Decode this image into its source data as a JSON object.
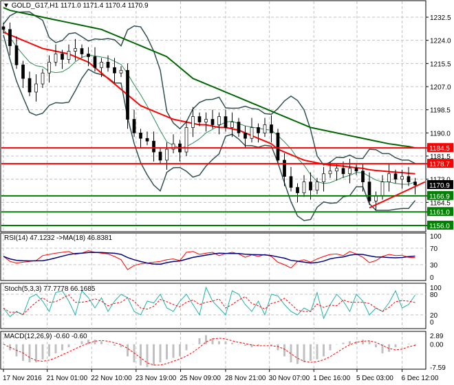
{
  "header": {
    "symbol": "GOLD_G17,H1",
    "ohlc": "1171.0 1171.4 1170.4 1170.9"
  },
  "rsi_label": "RSI(14) 47.1232  ->MA(18) 46.8381",
  "stoch_label": "Stoch(5,3,3) 77.7778 66.1685",
  "macd_label": "MACD(12,26,9) -0.60 -0.60",
  "colors": {
    "bull_bear_bars": "#000000",
    "ma_fast": "#ff0000",
    "ma_slow": "#006400",
    "bands": "#2f4f4f",
    "support": "#008000",
    "resistance": "#ff0000",
    "rsi": "#ff0000",
    "rsi_ma": "#000080",
    "stoch_main": "#20b2aa",
    "stoch_signal": "#ff0000",
    "macd_hist": "#c0c0c0"
  },
  "chart_data": [
    {
      "type": "line",
      "title": "GOLD_G17,H1",
      "y_ticks": [
        "1232.5",
        "1224.0",
        "1215.5",
        "1207.0",
        "1198.5",
        "1190.0",
        "1181.5",
        "1173.0",
        "1164.5"
      ],
      "ylim": [
        1154,
        1238
      ],
      "x_tick_labels": [
        "17 Nov 2016",
        "21 Nov 01:00",
        "22 Nov 10:00",
        "23 Nov 19:00",
        "25 Nov 09:00",
        "28 Nov 21:00",
        "30 Nov 07:00",
        "1 Dec 16:00",
        "5 Dec 03:00",
        "6 Dec 12:00"
      ],
      "x_tick_index": [
        0,
        6.7,
        13.5,
        20.3,
        27.1,
        34,
        40.7,
        47.5,
        54.1,
        61
      ],
      "close": [
        1228,
        1222,
        1215,
        1210,
        1205,
        1208,
        1212,
        1216,
        1219,
        1217,
        1220,
        1221,
        1219,
        1218,
        1214,
        1216,
        1214,
        1212,
        1213,
        1195,
        1190,
        1188,
        1187,
        1183,
        1180,
        1184,
        1186,
        1183,
        1192,
        1196,
        1194,
        1195,
        1193,
        1196,
        1192,
        1194,
        1190,
        1188,
        1192,
        1190,
        1193,
        1190,
        1180,
        1174,
        1170,
        1168,
        1172,
        1169,
        1172,
        1175,
        1176,
        1177,
        1175,
        1177,
        1176,
        1172,
        1165,
        1167,
        1172,
        1175,
        1173,
        1174,
        1172,
        1170.9
      ],
      "ma_red": [
        1227,
        1226,
        1225,
        1224,
        1223,
        1222,
        1221,
        1220.5,
        1220,
        1219.5,
        1219,
        1218,
        1217,
        1216,
        1214,
        1212,
        1210,
        1208,
        1206,
        1204,
        1202,
        1200,
        1199,
        1198,
        1197,
        1196,
        1195,
        1194.5,
        1194,
        1193.5,
        1193,
        1193,
        1192.5,
        1192,
        1192,
        1191.5,
        1191,
        1190,
        1189,
        1188,
        1187,
        1186,
        1184,
        1183,
        1182,
        1181,
        1180,
        1179.5,
        1179,
        1178.5,
        1178.2,
        1178,
        1177.8,
        1177.5,
        1177.2,
        1177,
        1176.5,
        1176.2,
        1176,
        1175.8,
        1175.6,
        1175.4,
        1175.2,
        1175
      ],
      "ma_green": [
        1236,
        1235,
        1234.5,
        1234,
        1233.5,
        1233,
        1232.5,
        1232,
        1231.5,
        1231,
        1230.5,
        1230,
        1229.5,
        1229,
        1228.5,
        1228,
        1227,
        1226,
        1225,
        1224,
        1223,
        1222,
        1221,
        1220,
        1219,
        1218,
        1216,
        1214,
        1212,
        1210,
        1209,
        1208,
        1207,
        1206,
        1205,
        1204,
        1203,
        1202,
        1201,
        1200,
        1199,
        1198,
        1197,
        1196,
        1195,
        1194,
        1193,
        1192,
        1191.5,
        1191,
        1190.5,
        1190,
        1189.5,
        1189,
        1188.5,
        1188,
        1187.5,
        1187,
        1186.5,
        1186,
        1185.7,
        1185.3,
        1185,
        1184.5
      ],
      "levels": [
        {
          "value": 1184.5,
          "label": "1184.5",
          "kind": "resistance"
        },
        {
          "value": 1178.7,
          "label": "1178.7",
          "kind": "resistance"
        },
        {
          "value": 1166.9,
          "label": "1166.9",
          "kind": "support"
        },
        {
          "value": 1161.0,
          "label": "1161.0",
          "kind": "support"
        },
        {
          "value": 1156.0,
          "label": "1156.0",
          "kind": "support"
        }
      ],
      "current_price": "1170.9",
      "trendline": {
        "from": [
          56,
          1162.5
        ],
        "to": [
          64.5,
          1172
        ]
      }
    },
    {
      "type": "line",
      "title": "RSI(14)",
      "ylim": [
        0,
        100
      ],
      "y_ticks": [
        "100",
        "70",
        "30",
        "0"
      ],
      "rsi": [
        50,
        38,
        34,
        36,
        38,
        40,
        52,
        55,
        58,
        60,
        62,
        55,
        58,
        64,
        60,
        58,
        56,
        50,
        42,
        18,
        28,
        32,
        34,
        36,
        38,
        42,
        44,
        40,
        60,
        62,
        55,
        58,
        60,
        52,
        57,
        60,
        56,
        48,
        54,
        50,
        55,
        50,
        36,
        30,
        22,
        38,
        42,
        36,
        44,
        50,
        55,
        56,
        52,
        62,
        56,
        48,
        35,
        40,
        50,
        55,
        52,
        53,
        48,
        47.1
      ],
      "stoch_main": [
        40,
        15,
        30,
        20,
        70,
        80,
        60,
        30,
        85,
        90,
        60,
        20,
        90,
        70,
        40,
        70,
        30,
        60,
        80,
        70,
        30,
        20,
        60,
        55,
        80,
        40,
        30,
        60,
        80,
        50,
        20,
        100,
        60,
        40,
        20,
        90,
        80,
        50,
        30,
        60,
        20,
        80,
        75,
        50,
        30,
        20,
        40,
        30,
        85,
        10,
        50,
        80,
        60,
        30,
        80,
        60,
        20,
        40,
        30,
        55,
        90,
        40,
        50,
        77.8
      ],
      "macd_hist": [
        0,
        -2,
        -4,
        -5.5,
        -6,
        -6,
        -5,
        -4,
        -3,
        -2,
        -1,
        0,
        1,
        1.5,
        1.5,
        1,
        0,
        -0.5,
        -1,
        -4,
        -6,
        -7,
        -7.5,
        -7,
        -6,
        -5,
        -4.5,
        -4,
        -2,
        0,
        2,
        3,
        2,
        1,
        1,
        0.5,
        0,
        -0.5,
        -1,
        -0.5,
        0,
        -0.5,
        -2,
        -4,
        -6,
        -6.5,
        -6,
        -5.5,
        -5,
        -4,
        -2,
        0,
        0.5,
        1,
        1,
        1.5,
        1,
        -1,
        -3,
        -2.5,
        -1,
        0,
        0.2,
        -0.6
      ],
      "macd_ticks": [
        "2.89",
        "0.00",
        "-7.59"
      ]
    }
  ]
}
